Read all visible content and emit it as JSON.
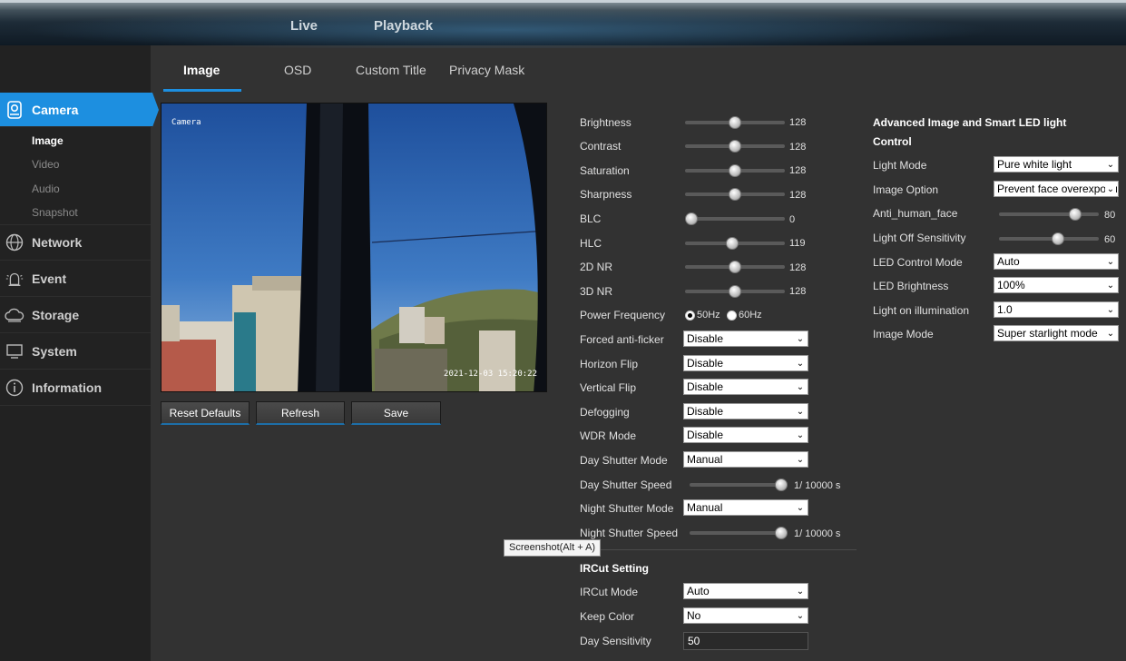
{
  "topnav": {
    "live": "Live",
    "playback": "Playback"
  },
  "sidebar": {
    "camera": "Camera",
    "sub": [
      "Image",
      "Video",
      "Audio",
      "Snapshot"
    ],
    "network": "Network",
    "event": "Event",
    "storage": "Storage",
    "system": "System",
    "information": "Information"
  },
  "tabs": [
    "Image",
    "OSD",
    "Custom Title",
    "Privacy Mask"
  ],
  "preview": {
    "cam_name": "Camera",
    "timestamp": "2021-12-03 15:20:22"
  },
  "buttons": {
    "reset": "Reset Defaults",
    "refresh": "Refresh",
    "save": "Save"
  },
  "sliders": {
    "brightness": {
      "label": "Brightness",
      "value": "128",
      "level": 0.5
    },
    "contrast": {
      "label": "Contrast",
      "value": "128",
      "level": 0.5
    },
    "saturation": {
      "label": "Saturation",
      "value": "128",
      "level": 0.5
    },
    "sharpness": {
      "label": "Sharpness",
      "value": "128",
      "level": 0.5
    },
    "blc": {
      "label": "BLC",
      "value": "0",
      "level": 0
    },
    "hlc": {
      "label": "HLC",
      "value": "119",
      "level": 0.47
    },
    "nr2d": {
      "label": "2D NR",
      "value": "128",
      "level": 0.5
    },
    "nr3d": {
      "label": "3D NR",
      "value": "128",
      "level": 0.5
    }
  },
  "power_frequency": {
    "label": "Power Frequency",
    "opt1": "50Hz",
    "opt2": "60Hz",
    "selected": "50Hz"
  },
  "selects": {
    "anti_flicker": {
      "label": "Forced anti-ficker",
      "value": "Disable"
    },
    "hflip": {
      "label": "Horizon Flip",
      "value": "Disable"
    },
    "vflip": {
      "label": "Vertical Flip",
      "value": "Disable"
    },
    "defog": {
      "label": "Defogging",
      "value": "Disable"
    },
    "wdr": {
      "label": "WDR Mode",
      "value": "Disable"
    },
    "day_shutter_mode": {
      "label": "Day Shutter Mode",
      "value": "Manual"
    },
    "night_shutter_mode": {
      "label": "Night Shutter Mode",
      "value": "Manual"
    }
  },
  "shutter": {
    "day_speed": {
      "label": "Day Shutter Speed",
      "value": "1/ 10000 s"
    },
    "night_speed": {
      "label": "Night Shutter Speed",
      "value": "1/ 10000 s"
    }
  },
  "tooltip": "Screenshot(Alt + A)",
  "ircut": {
    "heading": "IRCut Setting",
    "mode": {
      "label": "IRCut Mode",
      "value": "Auto"
    },
    "keep_color": {
      "label": "Keep Color",
      "value": "No"
    },
    "day_sensitivity": {
      "label": "Day Sensitivity",
      "value": "50"
    }
  },
  "advanced": {
    "heading1": "Advanced Image and Smart LED light",
    "heading2": "Control",
    "light_mode": {
      "label": "Light Mode",
      "value": "Pure white light"
    },
    "image_option": {
      "label": "Image Option",
      "value": "Prevent face overexposure"
    },
    "anti_face": {
      "label": "Anti_human_face",
      "value": "80",
      "level": 0.8
    },
    "light_off": {
      "label": "Light Off Sensitivity",
      "value": "60",
      "level": 0.6
    },
    "led_mode": {
      "label": "LED Control Mode",
      "value": "Auto"
    },
    "led_brightness": {
      "label": "LED Brightness",
      "value": "100%"
    },
    "light_on": {
      "label": "Light on illumination",
      "value": "1.0"
    },
    "image_mode": {
      "label": "Image Mode",
      "value": "Super starlight mode"
    }
  }
}
